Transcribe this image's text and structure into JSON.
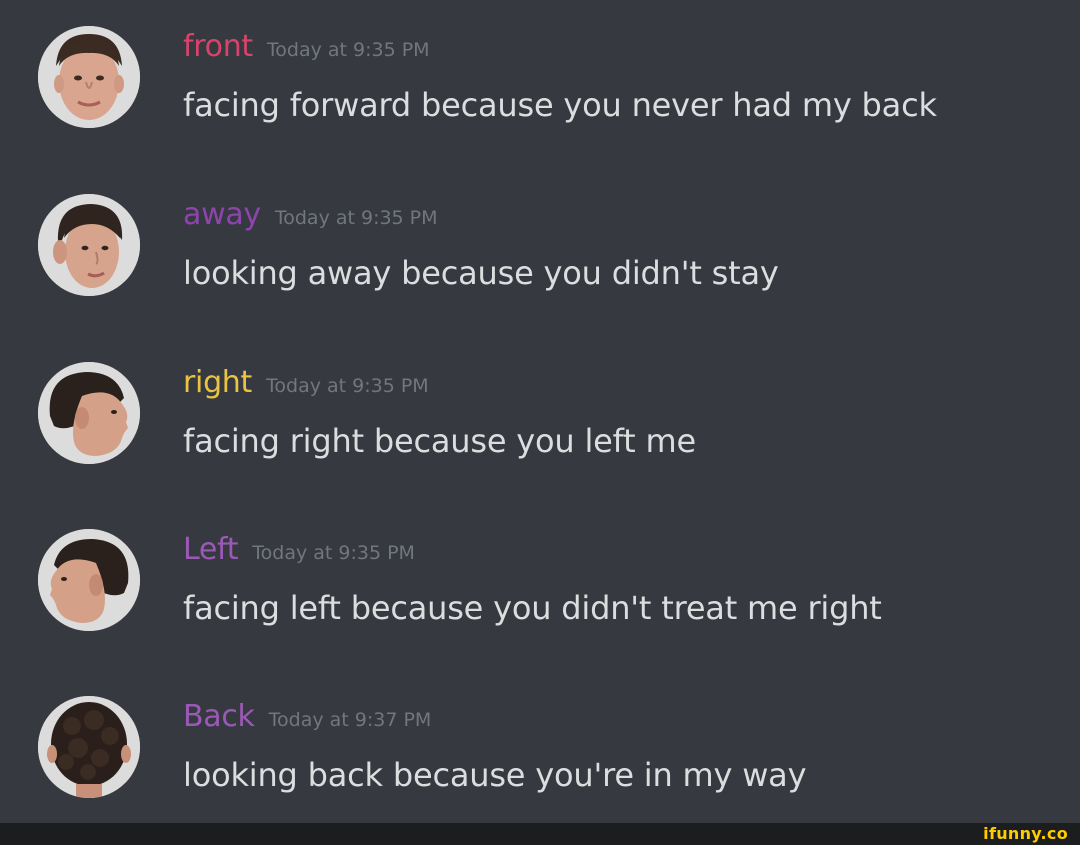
{
  "messages": [
    {
      "username": "front",
      "username_color": "#d8436b",
      "timestamp": "Today at 9:35 PM",
      "content": "facing forward because you never had my back",
      "avatar": "front-face-photo"
    },
    {
      "username": "away",
      "username_color": "#8e44ad",
      "timestamp": "Today at 9:35 PM",
      "content": "looking away because you didn't stay",
      "avatar": "three-quarter-face-photo"
    },
    {
      "username": "right",
      "username_color": "#e9c341",
      "timestamp": "Today at 9:35 PM",
      "content": "facing right because you left me",
      "avatar": "right-profile-photo"
    },
    {
      "username": "Left",
      "username_color": "#9b59b6",
      "timestamp": "Today at 9:35 PM",
      "content": "facing left because you didn't treat me right",
      "avatar": "left-profile-photo"
    },
    {
      "username": "Back",
      "username_color": "#9b59b6",
      "timestamp": "Today at 9:37 PM",
      "content": "looking back because you're in my way",
      "avatar": "back-of-head-photo"
    }
  ],
  "watermark": {
    "text": "ifunny.co",
    "color": "#ffcc00"
  }
}
